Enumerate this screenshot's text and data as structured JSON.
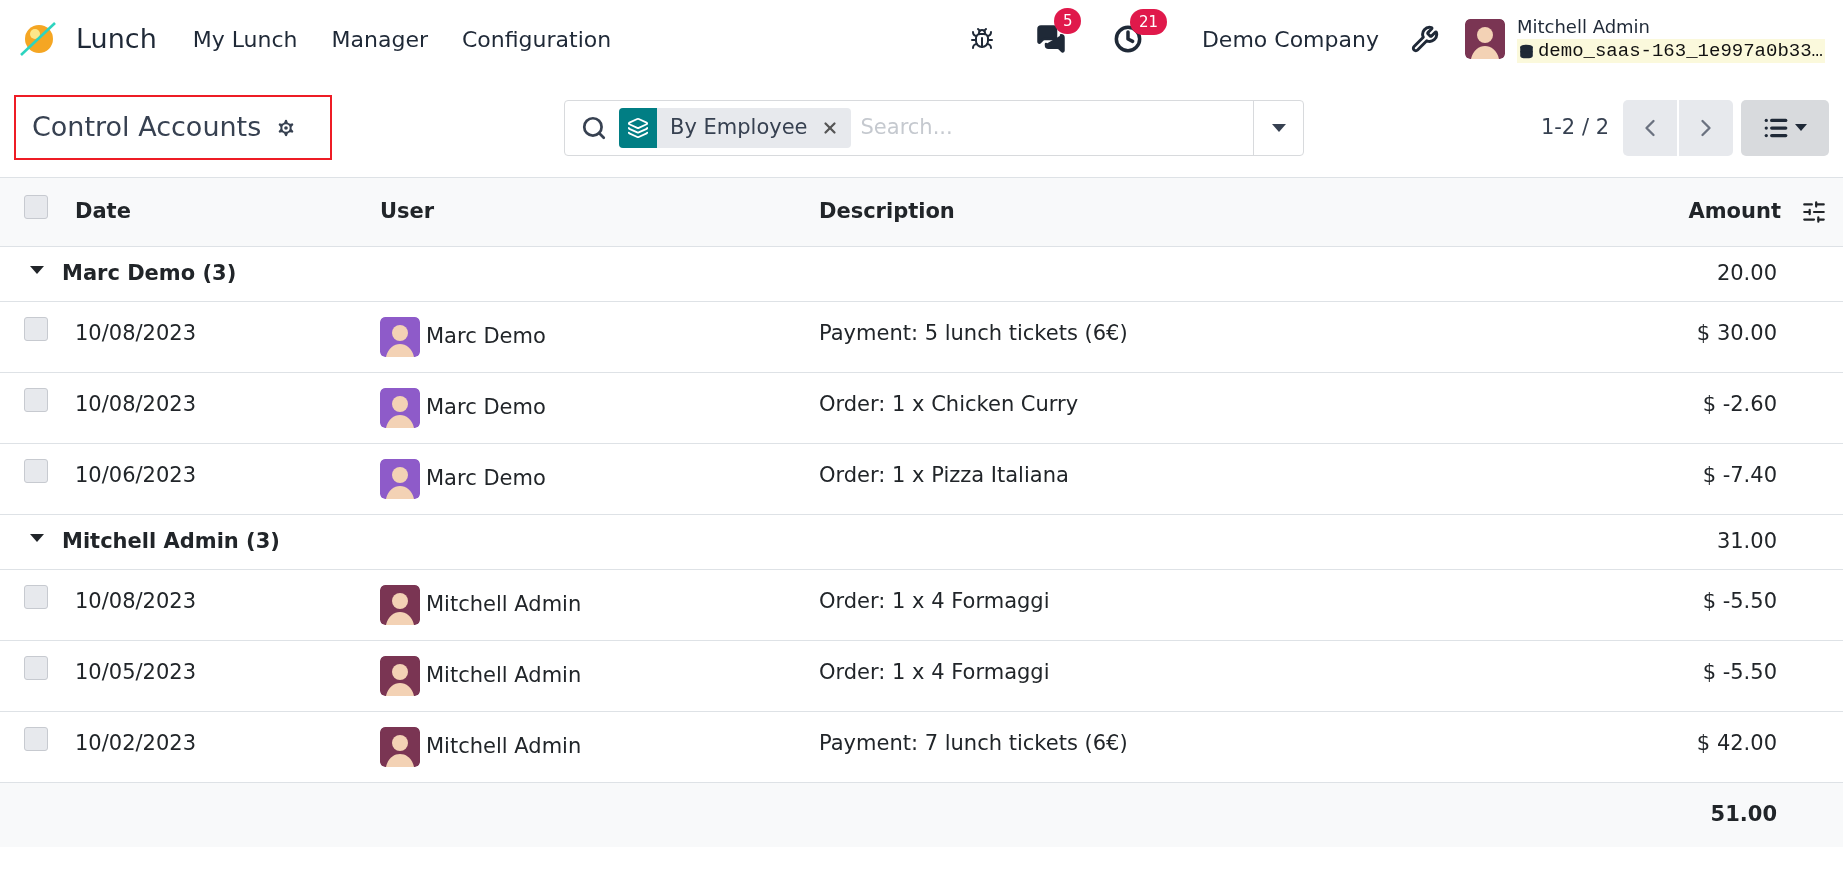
{
  "navbar": {
    "app_name": "Lunch",
    "menus": [
      "My Lunch",
      "Manager",
      "Configuration"
    ],
    "messages_count": "5",
    "activities_count": "21",
    "company": "Demo Company",
    "user": {
      "name": "Mitchell Admin",
      "database": "demo_saas-163_1e997a0b33…"
    }
  },
  "control_panel": {
    "title": "Control Accounts",
    "title_highlighted": true,
    "facet": {
      "label": "By Employee"
    },
    "search": {
      "placeholder": "Search..."
    },
    "pager": "1-2 / 2"
  },
  "table": {
    "select_all_checked": false,
    "columns": [
      "Date",
      "User",
      "Description",
      "Amount"
    ],
    "groups": [
      {
        "name": "Marc Demo (3)",
        "expanded": true,
        "total": "20.00",
        "rows": [
          {
            "date": "10/08/2023",
            "user": "Marc Demo",
            "color": "#8e5bc9",
            "description": "Payment: 5 lunch tickets (6€)",
            "amount": "$ 30.00",
            "checked": false
          },
          {
            "date": "10/08/2023",
            "user": "Marc Demo",
            "color": "#8e5bc9",
            "description": "Order: 1 x Chicken Curry",
            "amount": "$ -2.60",
            "checked": false
          },
          {
            "date": "10/06/2023",
            "user": "Marc Demo",
            "color": "#8e5bc9",
            "description": "Order: 1 x Pizza Italiana",
            "amount": "$ -7.40",
            "checked": false
          }
        ]
      },
      {
        "name": "Mitchell Admin (3)",
        "expanded": true,
        "total": "31.00",
        "rows": [
          {
            "date": "10/08/2023",
            "user": "Mitchell Admin",
            "color": "#7a3553",
            "description": "Order: 1 x 4 Formaggi",
            "amount": "$ -5.50",
            "checked": false
          },
          {
            "date": "10/05/2023",
            "user": "Mitchell Admin",
            "color": "#7a3553",
            "description": "Order: 1 x 4 Formaggi",
            "amount": "$ -5.50",
            "checked": false
          },
          {
            "date": "10/02/2023",
            "user": "Mitchell Admin",
            "color": "#7a3553",
            "description": "Payment: 7 lunch tickets (6€)",
            "amount": "$ 42.00",
            "checked": false
          }
        ]
      }
    ],
    "grand_total": "51.00"
  }
}
